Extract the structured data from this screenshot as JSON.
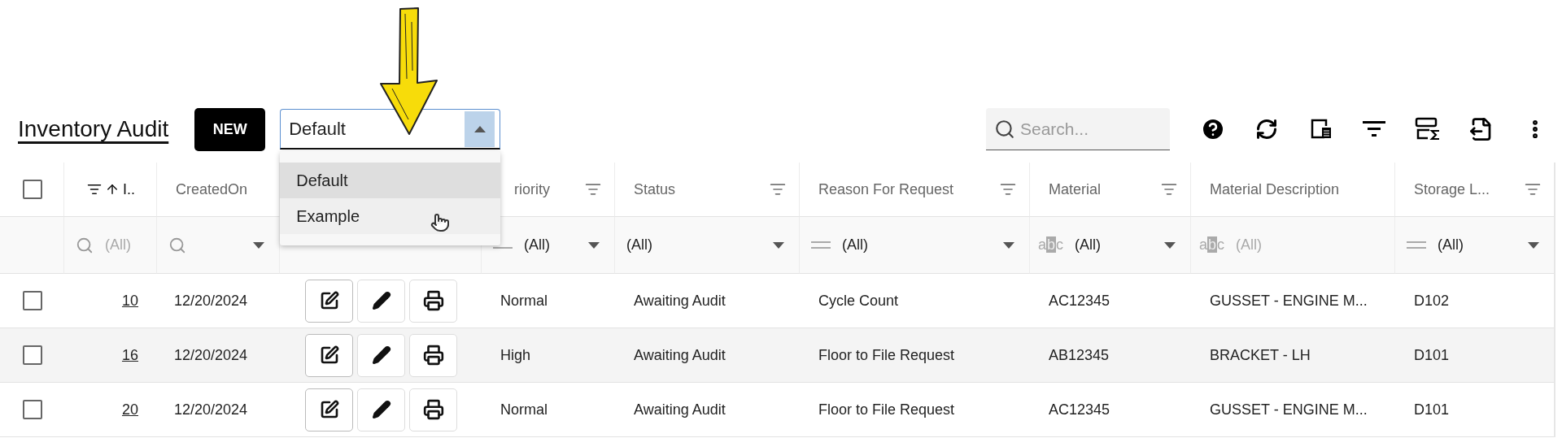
{
  "title": "Inventory Audit",
  "new_button": "NEW",
  "view_select": {
    "value": "Default",
    "expanded": true,
    "options": [
      {
        "label": "Default",
        "selected": true,
        "hovered": false
      },
      {
        "label": "Example",
        "selected": false,
        "hovered": true
      }
    ]
  },
  "search": {
    "placeholder": "Search..."
  },
  "table": {
    "header_checkbox": {
      "checked": false
    },
    "columns": [
      {
        "kind": "id",
        "label": "I..",
        "sort_ascending": true,
        "filter_icon": true
      },
      {
        "kind": "text",
        "label": "CreatedOn",
        "filter_icon": false
      },
      {
        "kind": "actions"
      },
      {
        "kind": "text",
        "label": "riority",
        "filter_icon": true
      },
      {
        "kind": "text",
        "label": "Status",
        "filter_icon": true
      },
      {
        "kind": "text",
        "label": "Reason For Request",
        "filter_icon": true
      },
      {
        "kind": "text",
        "label": "Material",
        "filter_icon": true
      },
      {
        "kind": "text",
        "label": "Material Description",
        "filter_icon": false
      },
      {
        "kind": "text",
        "label": "Storage L...",
        "filter_icon": true
      }
    ],
    "filters": [
      {
        "kind": "search",
        "value": "(All)",
        "dropdown": false
      },
      {
        "kind": "search",
        "dropdown": true
      },
      {
        "kind": "blank",
        "dropdown": false
      },
      {
        "kind": "dash",
        "value": "(All)",
        "dropdown": true
      },
      {
        "kind": "plain",
        "value": "(All)",
        "dropdown": true
      },
      {
        "kind": "equals",
        "value": "(All)",
        "dropdown": true
      },
      {
        "kind": "abc",
        "value": "(All)",
        "dropdown": true
      },
      {
        "kind": "abc",
        "value": "(All)",
        "dropdown": false
      },
      {
        "kind": "equals",
        "value": "(All)",
        "dropdown": true
      }
    ],
    "rows": [
      {
        "checked": false,
        "cells": [
          "10",
          "12/20/2024",
          "",
          "Normal",
          "Awaiting Audit",
          "Cycle Count",
          "AC12345",
          "GUSSET - ENGINE M...",
          "D102"
        ]
      },
      {
        "checked": false,
        "cells": [
          "16",
          "12/20/2024",
          "",
          "High",
          "Awaiting Audit",
          "Floor to File Request",
          "AB12345",
          "BRACKET - LH",
          "D101"
        ]
      },
      {
        "checked": false,
        "cells": [
          "20",
          "12/20/2024",
          "",
          "Normal",
          "Awaiting Audit",
          "Floor to File Request",
          "AC12345",
          "GUSSET - ENGINE M...",
          "D101"
        ]
      }
    ]
  }
}
